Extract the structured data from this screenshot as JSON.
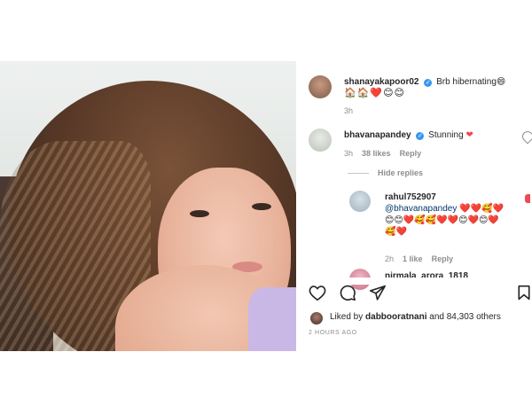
{
  "post": {
    "caption": {
      "username": "shanayakapoor02",
      "text": "Brb hibernating",
      "emojis_line1": "😄",
      "emojis_line2": "🏠🏠❤️😊😊",
      "time": "3h"
    },
    "comments": [
      {
        "username": "bhavanapandey",
        "text": "Stunning",
        "time": "3h",
        "likes": "38 likes",
        "reply_label": "Reply"
      }
    ],
    "hide_replies_label": "Hide replies",
    "replies": [
      {
        "username": "rahul752907",
        "mention": "@bhavanapandey",
        "emoji_text": "❤️❤️🥰❤️😊😊❤️🥰🥰❤️❤️😊❤️😊❤️🥰❤️",
        "time": "2h",
        "likes": "1 like",
        "reply_label": "Reply"
      },
      {
        "username": "nirmala_arora_1818"
      }
    ],
    "liked_by_prefix": "Liked by",
    "liked_by_user": "dabbooratnani",
    "liked_by_suffix": "and 84,303 others",
    "posted_time": "2 HOURS AGO"
  },
  "icons": {
    "like": "heart-outline-icon",
    "comment": "comment-icon",
    "share": "paper-plane-icon",
    "save": "bookmark-icon",
    "verified": "verified-badge-icon"
  },
  "colors": {
    "verified": "#3897f0",
    "heart": "#ed4956",
    "meta": "#8e8e8e"
  }
}
